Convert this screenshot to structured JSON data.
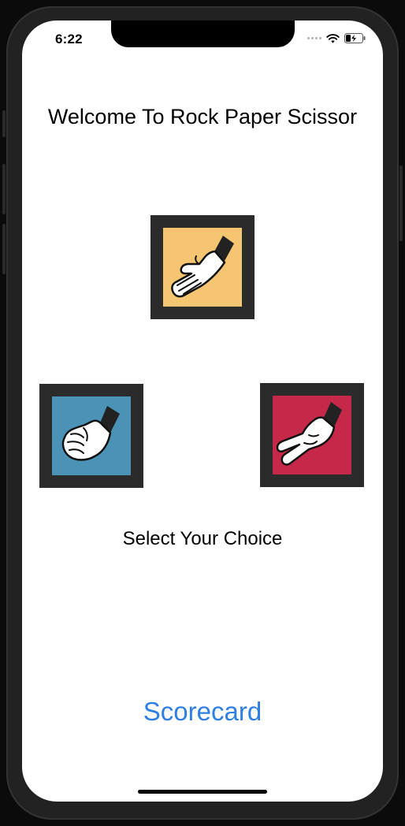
{
  "status_bar": {
    "time": "6:22"
  },
  "header": {
    "title": "Welcome To Rock Paper Scissor"
  },
  "choices": {
    "paper": {
      "name": "paper",
      "color": "#f6c572"
    },
    "rock": {
      "name": "rock",
      "color": "#4a93b6"
    },
    "scissor": {
      "name": "scissor",
      "color": "#c6284a"
    }
  },
  "prompt": {
    "label": "Select Your Choice"
  },
  "footer": {
    "scorecard_label": "Scorecard"
  },
  "icons": [
    "signal-icon",
    "wifi-icon",
    "battery-charging-icon",
    "paper-hand-icon",
    "rock-hand-icon",
    "scissor-hand-icon"
  ]
}
